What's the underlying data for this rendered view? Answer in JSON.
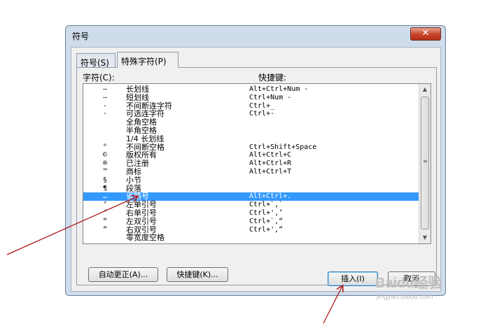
{
  "window": {
    "title": "符号",
    "close": "✕"
  },
  "tabs": {
    "symbols": "符号(S)",
    "special": "特殊字符(P)"
  },
  "columns": {
    "char": "字符(C):",
    "key": "快捷键:"
  },
  "rows": [
    {
      "char": "—",
      "name": "长划线",
      "key": "Alt+Ctrl+Num -"
    },
    {
      "char": "–",
      "name": "短划线",
      "key": "Ctrl+Num -"
    },
    {
      "char": "‑",
      "name": "不间断连字符",
      "key": "Ctrl+_"
    },
    {
      "char": "-",
      "name": "可选连字符",
      "key": "Ctrl+-"
    },
    {
      "char": "",
      "name": "全角空格",
      "key": ""
    },
    {
      "char": "",
      "name": "半角空格",
      "key": ""
    },
    {
      "char": "",
      "name": "1/4 长划线",
      "key": ""
    },
    {
      "char": "°",
      "name": "不间断空格",
      "key": "Ctrl+Shift+Space"
    },
    {
      "char": "©",
      "name": "版权所有",
      "key": "Alt+Ctrl+C"
    },
    {
      "char": "®",
      "name": "已注册",
      "key": "Alt+Ctrl+R"
    },
    {
      "char": "™",
      "name": "商标",
      "key": "Alt+Ctrl+T"
    },
    {
      "char": "§",
      "name": "小节",
      "key": ""
    },
    {
      "char": "¶",
      "name": "段落",
      "key": ""
    },
    {
      "char": "…",
      "name": "省略号",
      "key": "Alt+Ctrl+."
    },
    {
      "char": "‘",
      "name": "左单引号",
      "key": "Ctrl+`,`"
    },
    {
      "char": "’",
      "name": "右单引号",
      "key": "Ctrl+',’"
    },
    {
      "char": "“",
      "name": "左双引号",
      "key": "Ctrl+`,“"
    },
    {
      "char": "”",
      "name": "右双引号",
      "key": "Ctrl+',”"
    },
    {
      "char": "",
      "name": "零宽度空格",
      "key": ""
    }
  ],
  "selected_index": 13,
  "buttons": {
    "autocorrect": "自动更正(A)...",
    "shortcut": "快捷键(K)...",
    "insert": "插入(I)",
    "cancel": "取消"
  },
  "watermark": {
    "main": "Baidu经验",
    "sub": "jingyan.baidu.com"
  },
  "colors": {
    "selection": "#3399ff",
    "arrow": "#b01818"
  }
}
